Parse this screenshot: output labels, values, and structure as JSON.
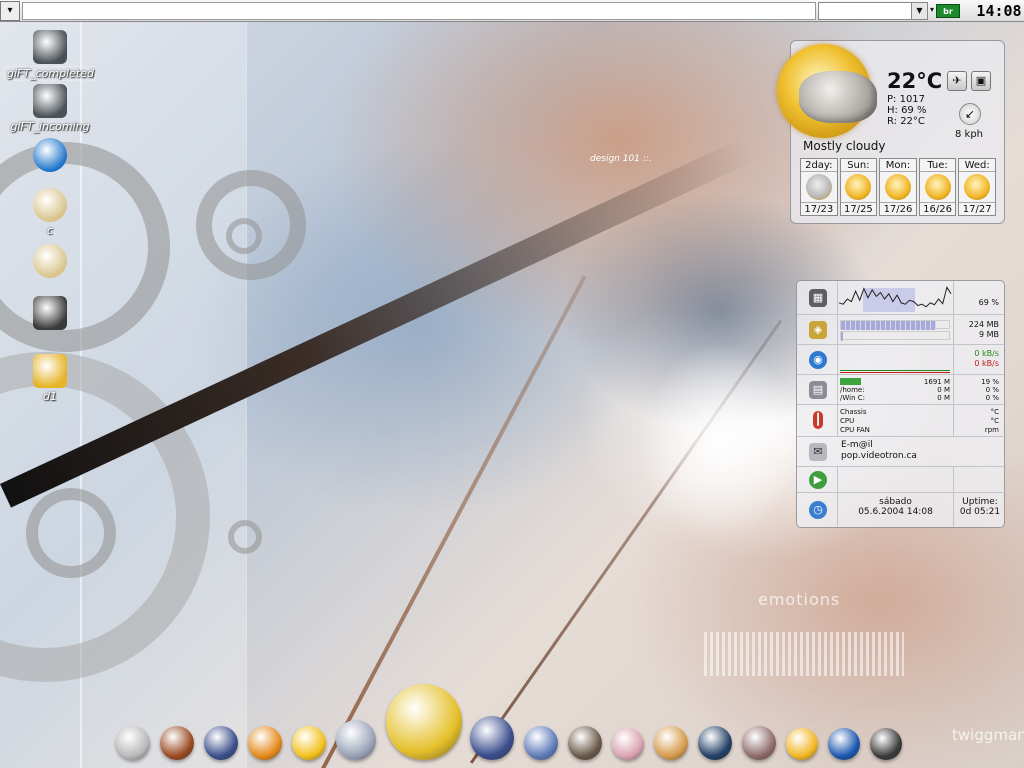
{
  "top_panel": {
    "menu_glyph": "▾",
    "combo_value": "",
    "combo_arrow": "▼",
    "arrow_glyph": "▾",
    "layout_code": "br",
    "clock": "14:08"
  },
  "desktop_icons": [
    {
      "name": "gift-completed",
      "label": "giFT_completed",
      "icon": "folder-drive-icon",
      "color": "#4b5257"
    },
    {
      "name": "gift-incoming",
      "label": "giFT_incoming",
      "icon": "folder-drive-icon",
      "color": "#4b5257"
    },
    {
      "name": "trash",
      "label": "",
      "icon": "trash-icon",
      "color": "#1a73c9"
    },
    {
      "name": "cdrom-1",
      "label": "c",
      "icon": "cdrom-icon",
      "color": "#d8c38a"
    },
    {
      "name": "cdrom-2",
      "label": "",
      "icon": "cdrom-icon",
      "color": "#d8c38a"
    },
    {
      "name": "speaker",
      "label": "",
      "icon": "speaker-icon",
      "color": "#3a3a3a"
    },
    {
      "name": "drive-d1",
      "label": "d1",
      "icon": "floppy-icon",
      "color": "#e5b428"
    }
  ],
  "wallpaper": {
    "emotions": "emotions",
    "signature": "twiggman",
    "small_label": "design 101 ::."
  },
  "weather": {
    "temperature": "22°C",
    "pressure": "P: 1017",
    "humidity": "H: 69 %",
    "realfeel": "R: 22°C",
    "wind": "8 kph",
    "condition": "Mostly cloudy",
    "btn_settings_glyph": "✈",
    "btn_radar_glyph": "▣",
    "wind_glyph": "↙",
    "forecast": [
      {
        "day": "2day:",
        "temps": "17/23",
        "cloudy": true
      },
      {
        "day": "Sun:",
        "temps": "17/25",
        "cloudy": false
      },
      {
        "day": "Mon:",
        "temps": "17/26",
        "cloudy": false
      },
      {
        "day": "Tue:",
        "temps": "16/26",
        "cloudy": false
      },
      {
        "day": "Wed:",
        "temps": "17/27",
        "cloudy": false
      }
    ]
  },
  "sysmon": {
    "cpu_percent": "69 %",
    "cpu_history": [
      0.35,
      0.3,
      0.5,
      0.4,
      0.8,
      0.45,
      0.9,
      0.55,
      0.85,
      0.6,
      0.75,
      0.5,
      0.7,
      0.4,
      0.65,
      0.35,
      0.3,
      0.45,
      0.4,
      0.25,
      0.3,
      0.2,
      0.35,
      0.28,
      0.5,
      0.32,
      0.95,
      0.7
    ],
    "mem_used": "224 MB",
    "swap_used": "9 MB",
    "mem_fraction": 0.88,
    "swap_fraction": 0.02,
    "net_in": "0 kB/s",
    "net_out": "0 kB/s",
    "disks": [
      {
        "label": "",
        "size": "1691 M",
        "pct": "19 %",
        "fraction": 0.19
      },
      {
        "label": "/home:",
        "size": "0 M",
        "pct": "0 %",
        "fraction": 0
      },
      {
        "label": "/Win C:",
        "size": "0 M",
        "pct": "0 %",
        "fraction": 0
      }
    ],
    "sensors": [
      {
        "label": "Chassis",
        "unit": "°C"
      },
      {
        "label": "CPU",
        "unit": "°C"
      },
      {
        "label": "CPU FAN",
        "unit": "rpm"
      }
    ],
    "mail_title": "E-m@il",
    "mail_server": "pop.videotron.ca",
    "day": "sábado",
    "datetime": "05.6.2004 14:08",
    "uptime_label": "Uptime:",
    "uptime_value": "0d 05:21",
    "icon_glyphs": {
      "cpu": "▦",
      "mem": "◈",
      "net": "◉",
      "disk": "▤",
      "temp": "┃",
      "mail": "✉",
      "play": "▶",
      "clock": "◷"
    }
  },
  "dock": [
    {
      "name": "dock-system-icon",
      "color": "#b9b9b9",
      "size": 34
    },
    {
      "name": "dock-home-icon",
      "color": "#9a4a22",
      "size": 34
    },
    {
      "name": "dock-security-icon",
      "color": "#3b4f8c",
      "size": 34
    },
    {
      "name": "dock-firefox-icon",
      "color": "#e58a1a",
      "size": 34
    },
    {
      "name": "dock-aim-icon",
      "color": "#f2c21d",
      "size": 34
    },
    {
      "name": "dock-cdplayer-icon",
      "color": "#9aa4b8",
      "size": 40
    },
    {
      "name": "dock-mascot-icon",
      "color": "#e5c02a",
      "size": 76
    },
    {
      "name": "dock-webcam-icon",
      "color": "#3c4f8e",
      "size": 44
    },
    {
      "name": "dock-media-icon",
      "color": "#5e7bb8",
      "size": 34
    },
    {
      "name": "dock-gimp-icon",
      "color": "#6a5a4a",
      "size": 34
    },
    {
      "name": "dock-feather-icon",
      "color": "#d9a3b0",
      "size": 32
    },
    {
      "name": "dock-settings-icon",
      "color": "#d59b4c",
      "size": 34
    },
    {
      "name": "dock-gears-icon",
      "color": "#233f66",
      "size": 34
    },
    {
      "name": "dock-tools-icon",
      "color": "#8f6a6a",
      "size": 34
    },
    {
      "name": "dock-warning-icon",
      "color": "#f1b622",
      "size": 32
    },
    {
      "name": "dock-pen-icon",
      "color": "#1b56b0",
      "size": 32
    },
    {
      "name": "dock-speaker-icon",
      "color": "#3a3a3a",
      "size": 32
    }
  ]
}
